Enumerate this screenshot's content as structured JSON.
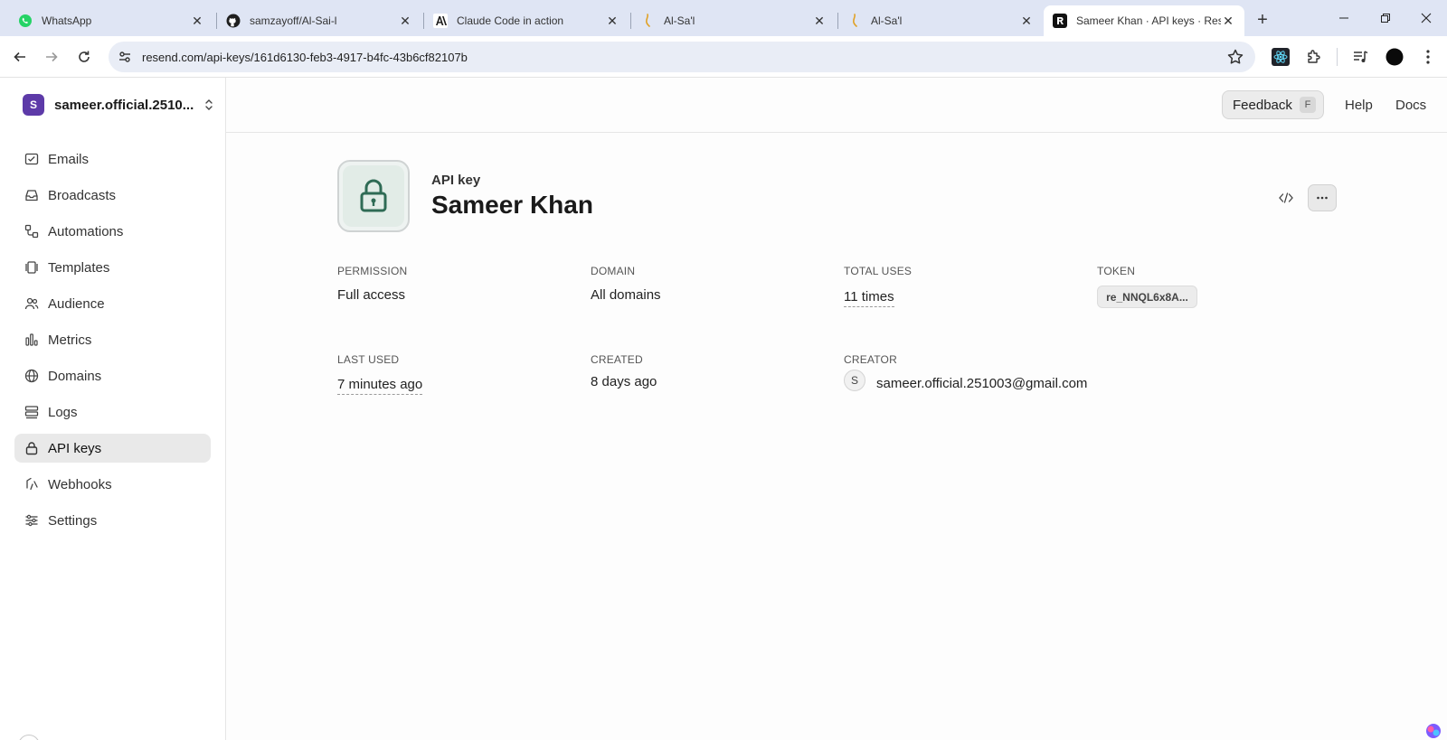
{
  "browser": {
    "tabs": [
      {
        "title": "WhatsApp",
        "icon": "whatsapp-icon"
      },
      {
        "title": "samzayoff/Al-Sai-l",
        "icon": "github-icon"
      },
      {
        "title": "Claude Code in action",
        "icon": "anthropic-icon"
      },
      {
        "title": "Al-Sa'l",
        "icon": "al-sail-icon"
      },
      {
        "title": "Al-Sa'l",
        "icon": "al-sail-icon"
      },
      {
        "title": "Sameer Khan · API keys · Rese",
        "icon": "resend-icon",
        "active": true
      }
    ],
    "url": "resend.com/api-keys/161d6130-feb3-4917-b4fc-43b6cf82107b"
  },
  "sidebar": {
    "team_initial": "S",
    "team_name": "sameer.official.2510...",
    "items": [
      {
        "label": "Emails",
        "icon": "mail-check-icon"
      },
      {
        "label": "Broadcasts",
        "icon": "inbox-icon"
      },
      {
        "label": "Automations",
        "icon": "workflow-icon"
      },
      {
        "label": "Templates",
        "icon": "templates-icon"
      },
      {
        "label": "Audience",
        "icon": "users-icon"
      },
      {
        "label": "Metrics",
        "icon": "bar-chart-icon"
      },
      {
        "label": "Domains",
        "icon": "globe-icon"
      },
      {
        "label": "Logs",
        "icon": "logs-icon"
      },
      {
        "label": "API keys",
        "icon": "lock-icon",
        "active": true
      },
      {
        "label": "Webhooks",
        "icon": "webhook-icon"
      },
      {
        "label": "Settings",
        "icon": "sliders-icon"
      }
    ]
  },
  "header": {
    "feedback_label": "Feedback",
    "feedback_shortcut": "F",
    "help_label": "Help",
    "docs_label": "Docs"
  },
  "api_key": {
    "eyebrow": "API key",
    "name": "Sameer Khan",
    "fields": {
      "permission_label": "PERMISSION",
      "permission_value": "Full access",
      "domain_label": "DOMAIN",
      "domain_value": "All domains",
      "total_uses_label": "TOTAL USES",
      "total_uses_value": "11 times",
      "token_label": "TOKEN",
      "token_value": "re_NNQL6x8A...",
      "last_used_label": "LAST USED",
      "last_used_value": "7 minutes ago",
      "created_label": "CREATED",
      "created_value": "8 days ago",
      "creator_label": "CREATOR",
      "creator_initial": "S",
      "creator_email": "sameer.official.251003@gmail.com"
    }
  },
  "colors": {
    "accent_team": "#5d3aa8",
    "tab_strip": "#dfe5f4",
    "lock_icon": "#2f6b55"
  }
}
